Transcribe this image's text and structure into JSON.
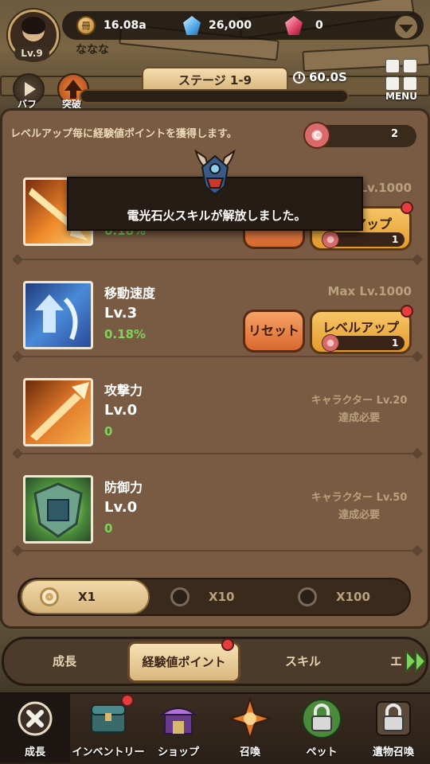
{
  "player": {
    "level": "Lv.9",
    "name": "ななな"
  },
  "currencies": {
    "gold": {
      "icon": "gold-coin-icon",
      "glyph": "冊",
      "value": "16.08a"
    },
    "diamond": {
      "icon": "blue-diamond-icon",
      "value": "26,000"
    },
    "ruby": {
      "icon": "red-gem-icon",
      "value": "0"
    }
  },
  "menu": {
    "label": "MENU"
  },
  "side_buttons": {
    "buff": "バフ",
    "breakthrough": "突破"
  },
  "stage": {
    "label": "ステージ 1-9",
    "timer": "60.0S"
  },
  "panel": {
    "info": "レベルアップ毎に経験値ポイントを獲得します。",
    "points": {
      "icon": "exp-point-icon",
      "glyph": "C",
      "value": "2"
    }
  },
  "skills": [
    {
      "name": "",
      "level": "",
      "pct": "0.18%",
      "max_level": "Lv.1000",
      "reset_label": "",
      "levelup_label": "アップ",
      "cost": "1"
    },
    {
      "name": "移動速度",
      "level": "Lv.3",
      "pct": "0.18%",
      "max_level": "Max Lv.1000",
      "reset_label": "リセット",
      "levelup_label": "レベルアップ",
      "cost": "1"
    },
    {
      "name": "攻撃力",
      "level": "Lv.0",
      "pct": "0",
      "requirement_line1": "キャラクター Lv.20",
      "requirement_line2": "達成必要"
    },
    {
      "name": "防御力",
      "level": "Lv.0",
      "pct": "0",
      "requirement_line1": "キャラクター Lv.50",
      "requirement_line2": "達成必要"
    }
  ],
  "toast": {
    "message": "電光石火スキルが解放しました。"
  },
  "multipliers": [
    {
      "label": "X1",
      "selected": true
    },
    {
      "label": "X10",
      "selected": false
    },
    {
      "label": "X100",
      "selected": false
    }
  ],
  "categories": {
    "growth": "成長",
    "exp_points": "経験値ポイント",
    "skill": "スキル",
    "partial": "エ"
  },
  "nav": [
    {
      "label": "成長",
      "icon": "close-x-icon"
    },
    {
      "label": "インベントリー",
      "icon": "chest-icon"
    },
    {
      "label": "ショップ",
      "icon": "shop-icon"
    },
    {
      "label": "召喚",
      "icon": "summon-star-icon"
    },
    {
      "label": "ペット",
      "icon": "lock-icon"
    },
    {
      "label": "遺物召喚",
      "icon": "lock-icon"
    }
  ],
  "colors": {
    "panel": "#785b42",
    "accent_orange": "#e39a2c",
    "percent_green": "#7ed35a",
    "notify_red": "#e53d3d"
  }
}
